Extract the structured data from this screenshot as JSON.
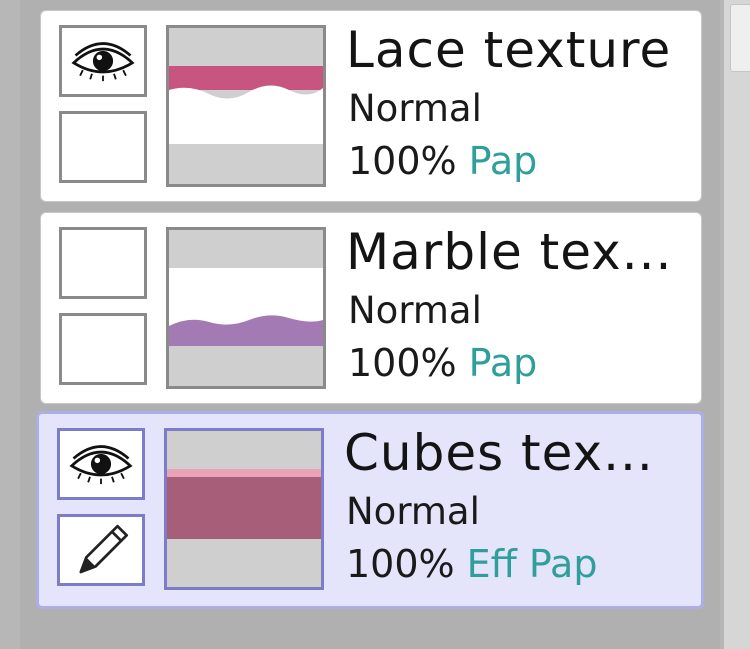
{
  "colors": {
    "accent_tag": "#2e9f9a",
    "selected_bg": "#e4e4fb",
    "selected_border": "#aeaee6"
  },
  "layers": [
    {
      "name": "Lace texture",
      "blend_mode": "Normal",
      "opacity": "100%",
      "tags": [
        "Pap"
      ],
      "visible": true,
      "edit_icon": false,
      "selected": false,
      "thumbnail_icon": "pink-wave-band"
    },
    {
      "name": "Marble tex...",
      "blend_mode": "Normal",
      "opacity": "100%",
      "tags": [
        "Pap"
      ],
      "visible": false,
      "edit_icon": false,
      "selected": false,
      "thumbnail_icon": "purple-wave-band"
    },
    {
      "name": "Cubes tex...",
      "blend_mode": "Normal",
      "opacity": "100%",
      "tags": [
        "Eff",
        "Pap"
      ],
      "visible": true,
      "edit_icon": true,
      "selected": true,
      "thumbnail_icon": "mauve-solid-band"
    }
  ]
}
